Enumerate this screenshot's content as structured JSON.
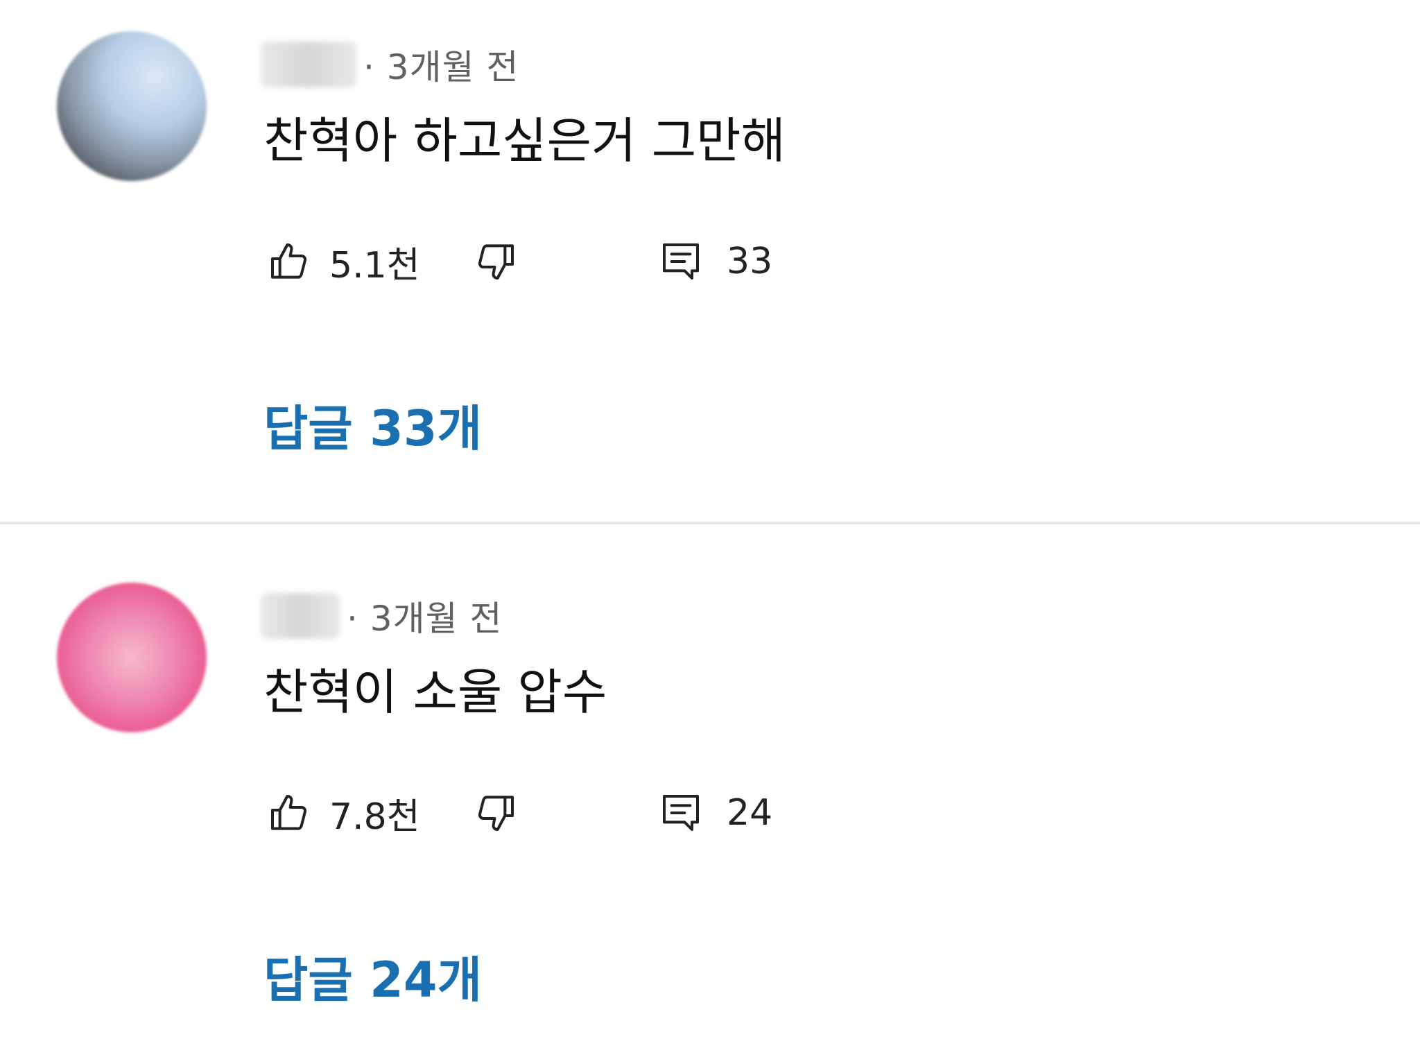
{
  "comments": [
    {
      "time": "· 3개월 전",
      "text": "찬혁아 하고싶은거 그만해",
      "likes": "5.1천",
      "reply_count": "33",
      "replies_label": "답글 33개",
      "avatar_color": "#b6cde6"
    },
    {
      "time": "· 3개월 전",
      "text": "찬혁이 소울 압수",
      "likes": "7.8천",
      "reply_count": "24",
      "replies_label": "답글 24개",
      "avatar_color": "#ea5f93"
    }
  ],
  "icons": {
    "like": "thumbs-up-icon",
    "dislike": "thumbs-down-icon",
    "reply": "comment-icon"
  },
  "colors": {
    "link": "#1a6fb0",
    "meta": "#606060",
    "divider": "#e6e6e6"
  }
}
